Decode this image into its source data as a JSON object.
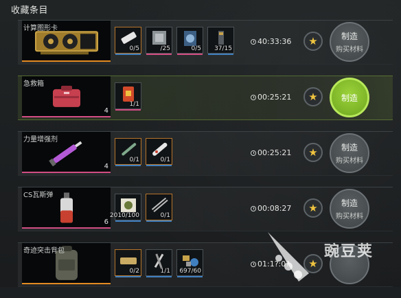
{
  "header": {
    "title": "收藏条目"
  },
  "colors": {
    "orange": "#e48b21",
    "pink": "#d24d83",
    "blue": "#3f7fc0",
    "green_active": "#9bd23a"
  },
  "items": [
    {
      "name": "计算图形卡",
      "count": "",
      "line_color": "#e48b21",
      "art": "gpu-icon",
      "timer": "40:33:36",
      "craft_label": "制造",
      "buy_label": "购买材料",
      "active": false,
      "materials": [
        {
          "count": "0/5",
          "icon": "bandage-icon",
          "orange": true,
          "bar": "#3f7fc0"
        },
        {
          "count": "/25",
          "icon": "cpu-icon",
          "orange": false,
          "bar": "#d24d83"
        },
        {
          "count": "0/5",
          "icon": "fan-icon",
          "orange": false,
          "bar": "#d24d83"
        },
        {
          "count": "37/15",
          "icon": "capacitor-icon",
          "orange": false,
          "bar": "#3f7fc0"
        }
      ]
    },
    {
      "name": "急救箱",
      "count": "4",
      "line_color": "#d24d83",
      "art": "medkit-icon",
      "timer": "00:25:21",
      "craft_label": "制造",
      "buy_label": "",
      "active": true,
      "materials": [
        {
          "count": "1/1",
          "icon": "medical-bag-icon",
          "orange": false,
          "bar": "#d24d83"
        }
      ]
    },
    {
      "name": "力量增强剂",
      "count": "4",
      "line_color": "#d24d83",
      "art": "syringe-icon",
      "timer": "00:25:21",
      "craft_label": "制造",
      "buy_label": "购买材料",
      "active": false,
      "materials": [
        {
          "count": "0/1",
          "icon": "injector-icon",
          "orange": true,
          "bar": "#3f7fc0"
        },
        {
          "count": "0/1",
          "icon": "vial-icon",
          "orange": true,
          "bar": "#3f7fc0"
        }
      ]
    },
    {
      "name": "CS瓦斯弹",
      "count": "6",
      "line_color": "#d24d83",
      "art": "grenade-icon",
      "timer": "00:08:27",
      "craft_label": "制造",
      "buy_label": "购买材料",
      "active": false,
      "materials": [
        {
          "count": "2010/100",
          "icon": "powder-icon",
          "orange": false,
          "bar": "#3f7fc0"
        },
        {
          "count": "0/1",
          "icon": "rods-icon",
          "orange": true,
          "bar": "#3f7fc0"
        }
      ]
    },
    {
      "name": "奇迹突击背包",
      "count": "",
      "line_color": "#e48b21",
      "art": "backpack-icon",
      "timer": "01:1?:0?",
      "craft_label": "",
      "buy_label": "",
      "active": false,
      "materials": [
        {
          "count": "0/2",
          "icon": "fabric-icon",
          "orange": true,
          "bar": "#3f7fc0"
        },
        {
          "count": "1/1",
          "icon": "tools-icon",
          "orange": false,
          "bar": "#3f7fc0"
        },
        {
          "count": "697/60",
          "icon": "parts-icon",
          "orange": false,
          "bar": "#3f7fc0"
        }
      ]
    }
  ],
  "watermark": {
    "text": "豌豆荚"
  }
}
